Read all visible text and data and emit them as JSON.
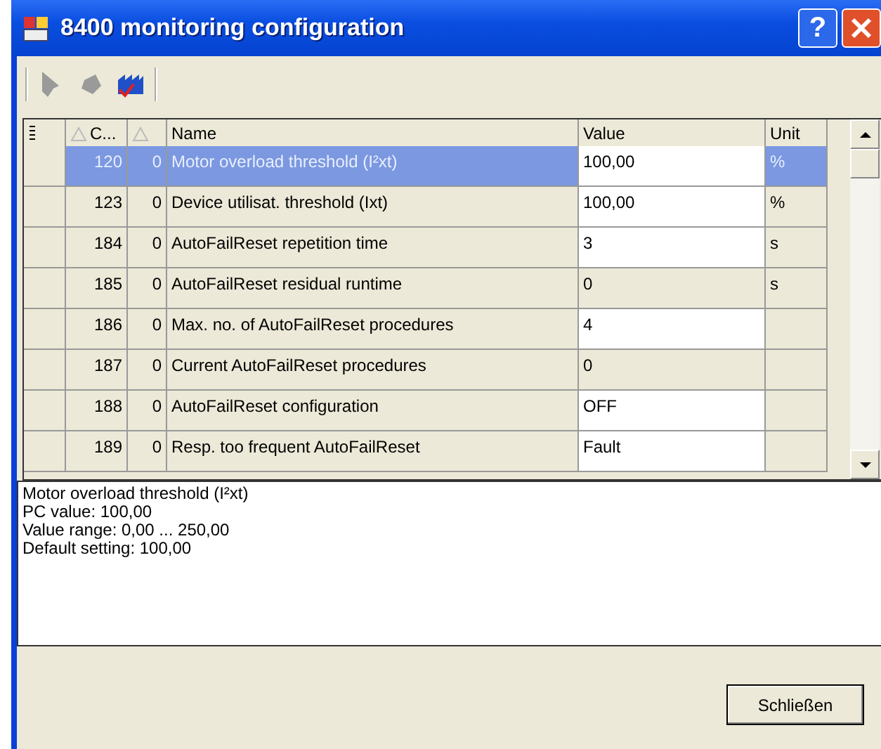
{
  "window": {
    "title": "8400 monitoring configuration",
    "help": "?"
  },
  "toolbar": {
    "buttons": [
      {
        "kind": "write",
        "disabled": true
      },
      {
        "kind": "read",
        "disabled": true
      },
      {
        "kind": "factory",
        "disabled": false
      }
    ]
  },
  "table": {
    "columns": [
      {
        "kind": "indicator"
      },
      {
        "kind": "code",
        "label": "C...",
        "sorted": true
      },
      {
        "kind": "sub",
        "sorted": true
      },
      {
        "kind": "name",
        "label": "Name"
      },
      {
        "kind": "value",
        "label": "Value"
      },
      {
        "kind": "unit",
        "label": "Unit"
      }
    ],
    "rows": [
      {
        "code": "120",
        "sub": "0",
        "name": "Motor overload threshold (I²xt)",
        "value": "100,00",
        "unit": "%",
        "editable": true,
        "selected": true
      },
      {
        "code": "123",
        "sub": "0",
        "name": "Device utilisat. threshold (Ixt)",
        "value": "100,00",
        "unit": "%",
        "editable": true,
        "selected": false
      },
      {
        "code": "184",
        "sub": "0",
        "name": "AutoFailReset repetition time",
        "value": "3",
        "unit": "s",
        "editable": true,
        "selected": false
      },
      {
        "code": "185",
        "sub": "0",
        "name": "AutoFailReset residual runtime",
        "value": "0",
        "unit": "s",
        "editable": false,
        "selected": false
      },
      {
        "code": "186",
        "sub": "0",
        "name": "Max. no. of AutoFailReset procedures",
        "value": "4",
        "unit": "",
        "editable": true,
        "selected": false
      },
      {
        "code": "187",
        "sub": "0",
        "name": "Current AutoFailReset procedures",
        "value": "0",
        "unit": "",
        "editable": false,
        "selected": false
      },
      {
        "code": "188",
        "sub": "0",
        "name": "AutoFailReset configuration",
        "value": "OFF",
        "unit": "",
        "editable": true,
        "selected": false
      },
      {
        "code": "189",
        "sub": "0",
        "name": "Resp. too frequent AutoFailReset",
        "value": "Fault",
        "unit": "",
        "editable": true,
        "selected": false
      }
    ]
  },
  "description": [
    "Motor overload threshold (I²xt)",
    "PC value: 100,00",
    "Value range: 0,00 ... 250,00",
    "Default setting: 100,00"
  ],
  "buttons": [
    {
      "label": "Schließen"
    }
  ]
}
